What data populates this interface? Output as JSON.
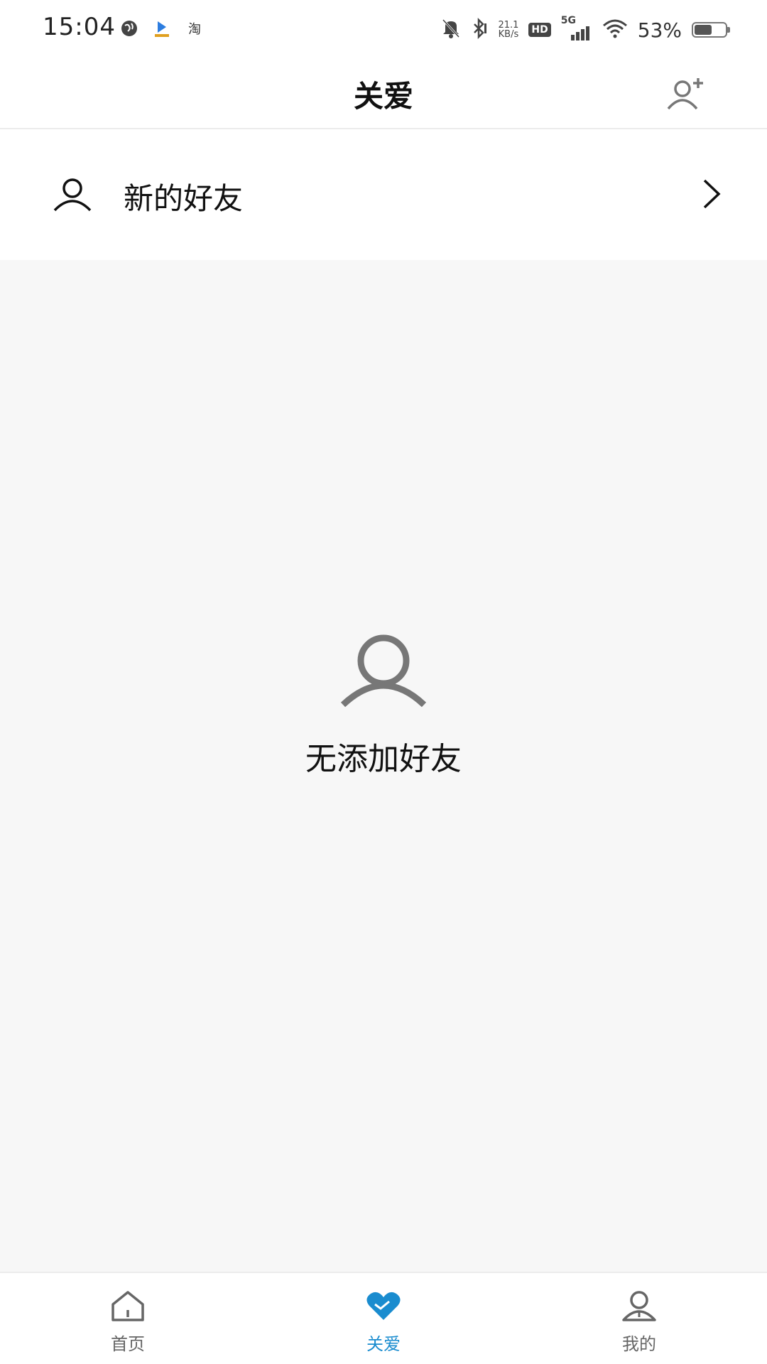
{
  "status_bar": {
    "time": "15:04",
    "taobao_label": "淘",
    "net_speed_value": "21.1",
    "net_speed_unit": "KB/s",
    "hd_label": "HD",
    "network_label": "5G",
    "battery_percent": "53%"
  },
  "header": {
    "title": "关爱"
  },
  "new_friends": {
    "label": "新的好友"
  },
  "empty_state": {
    "message": "无添加好友"
  },
  "bottom_nav": {
    "items": [
      {
        "label": "首页",
        "icon": "home-icon",
        "active": false
      },
      {
        "label": "关爱",
        "icon": "heart-icon",
        "active": true
      },
      {
        "label": "我的",
        "icon": "profile-icon",
        "active": false
      }
    ]
  },
  "colors": {
    "accent": "#1a8ccf",
    "background": "#f7f7f7",
    "surface": "#ffffff",
    "icon_gray": "#777777"
  }
}
